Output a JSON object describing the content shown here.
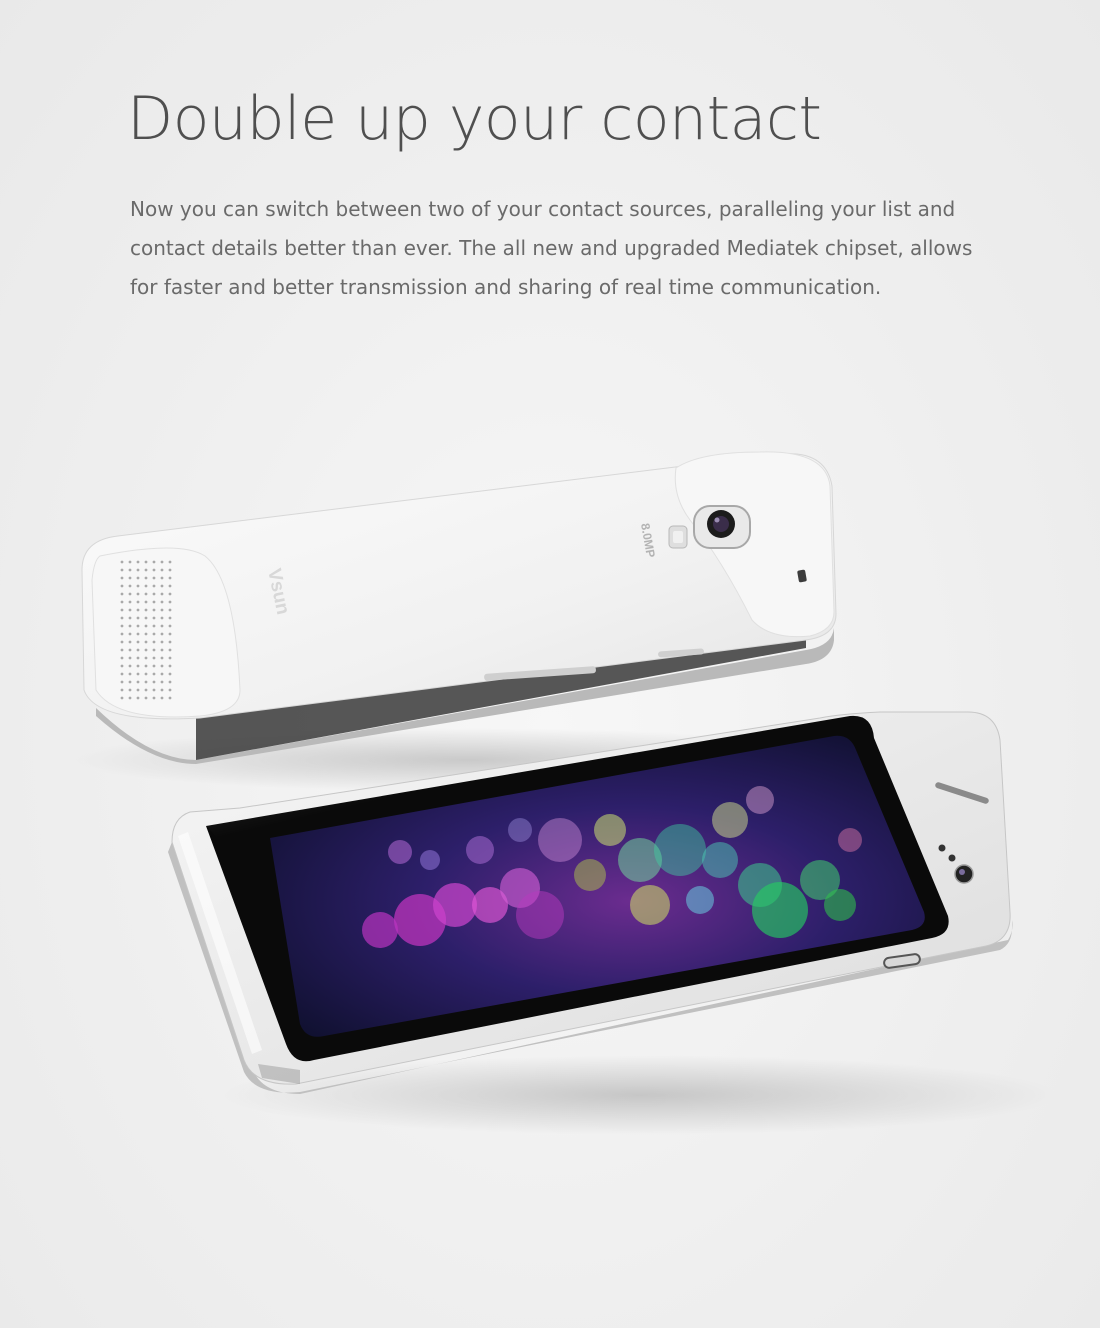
{
  "hero": {
    "headline": "Double up your contact",
    "body": "Now you can switch between two of your contact sources, paralleling your list and contact details better than ever. The all new and upgraded Mediatek chipset, allows for faster and better transmission and sharing of real time communication."
  },
  "product_image": {
    "brand_logo": "Vsun",
    "camera_label": "8.0MP"
  },
  "colors": {
    "background": "#efefef",
    "heading": "#4f4f4f",
    "text": "#6a6a6a",
    "phone_body": "#f4f4f4",
    "phone_frame": "#c9c9c9"
  }
}
